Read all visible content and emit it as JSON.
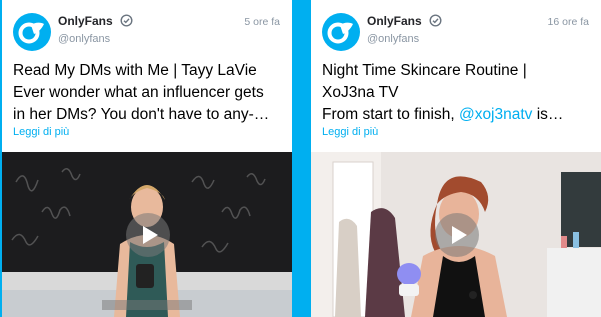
{
  "posts": [
    {
      "account_name": "OnlyFans",
      "handle": "@onlyfans",
      "time": "5 ore fa",
      "text_lines": [
        "Read My DMs with Me | Tayy LaVie",
        "Ever wonder what an influencer gets",
        "in her DMs? You don't have to any-…"
      ],
      "read_more": "Leggi di più"
    },
    {
      "account_name": "OnlyFans",
      "handle": "@onlyfans",
      "time": "16 ore fa",
      "text_lines": [
        "Night Time Skincare Routine |",
        "XoJ3na TV"
      ],
      "text_line3_prefix": "From start to finish, ",
      "mention": "@xoj3natv",
      "text_line3_suffix": " is…",
      "read_more": "Leggi di più"
    }
  ],
  "icons": {
    "avatar": "onlyfans-logo-icon",
    "verified": "verified-check-icon",
    "play": "play-icon"
  },
  "colors": {
    "brand": "#00aff0",
    "text": "#000000",
    "muted": "#8a96a3"
  }
}
